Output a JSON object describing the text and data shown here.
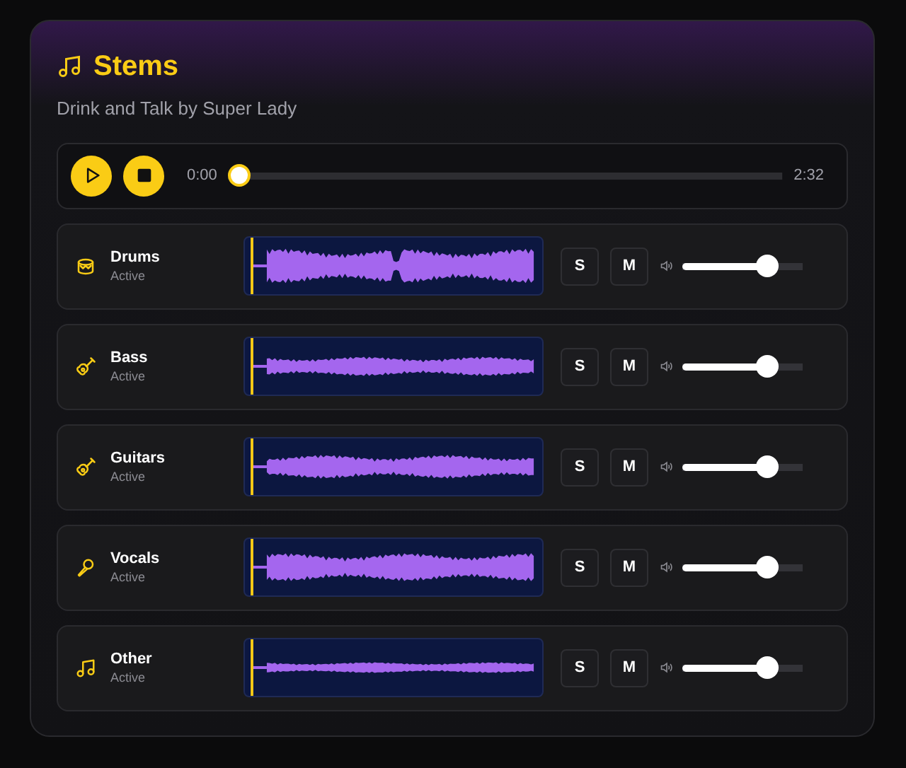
{
  "title": "Stems",
  "subtitle": "Drink and Talk by Super Lady",
  "transport": {
    "current": "0:00",
    "total": "2:32",
    "level": 0,
    "playing": false
  },
  "stems": [
    {
      "kind": "drums",
      "name": "Drums",
      "status": "Active",
      "solo_label": "S",
      "solo": false,
      "mute_label": "M",
      "muted": false,
      "level": 0.75
    },
    {
      "kind": "bass",
      "name": "Bass",
      "status": "Active",
      "solo_label": "S",
      "solo": false,
      "mute_label": "M",
      "muted": false,
      "level": 0.75
    },
    {
      "kind": "guitar",
      "name": "Guitars",
      "status": "Active",
      "solo_label": "S",
      "solo": false,
      "mute_label": "M",
      "muted": false,
      "level": 0.75
    },
    {
      "kind": "vocals",
      "name": "Vocals",
      "status": "Active",
      "solo_label": "S",
      "solo": false,
      "mute_label": "M",
      "muted": false,
      "level": 0.75
    },
    {
      "kind": "other",
      "name": "Other",
      "status": "Active",
      "solo_label": "S",
      "solo": false,
      "mute_label": "M",
      "muted": false,
      "level": 0.75
    }
  ]
}
